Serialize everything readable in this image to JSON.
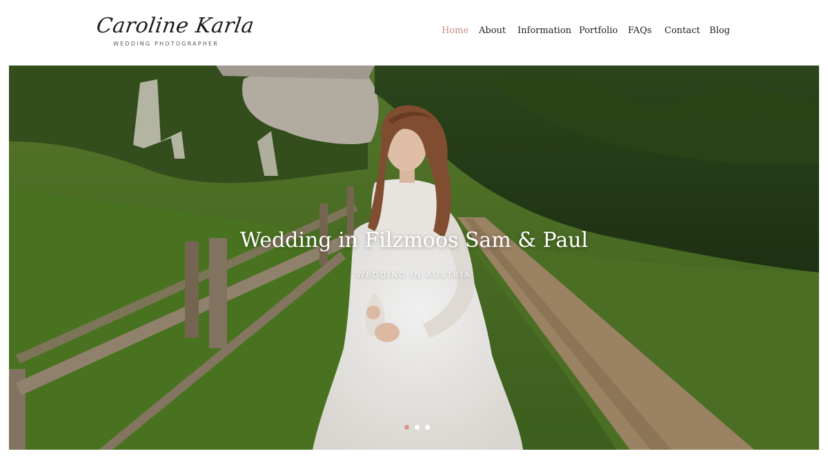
{
  "brand": {
    "name": "Caroline Karla",
    "tagline": "WEDDING PHOTOGRAPHER"
  },
  "nav": {
    "items": [
      {
        "label": "Home",
        "active": true
      },
      {
        "label": "About"
      },
      {
        "label": "Information"
      },
      {
        "label": "Portfolio"
      },
      {
        "label": "FAQs"
      },
      {
        "label": "Contact"
      },
      {
        "label": "Blog"
      }
    ]
  },
  "hero": {
    "title": "Wedding in Filzmoos Sam & Paul",
    "subtitle": "WEDDING IN AUSTRIA",
    "slide_count": 3,
    "active_slide": 1
  },
  "colors": {
    "accent": "#c98b7e",
    "dot_active": "#d9938a"
  }
}
